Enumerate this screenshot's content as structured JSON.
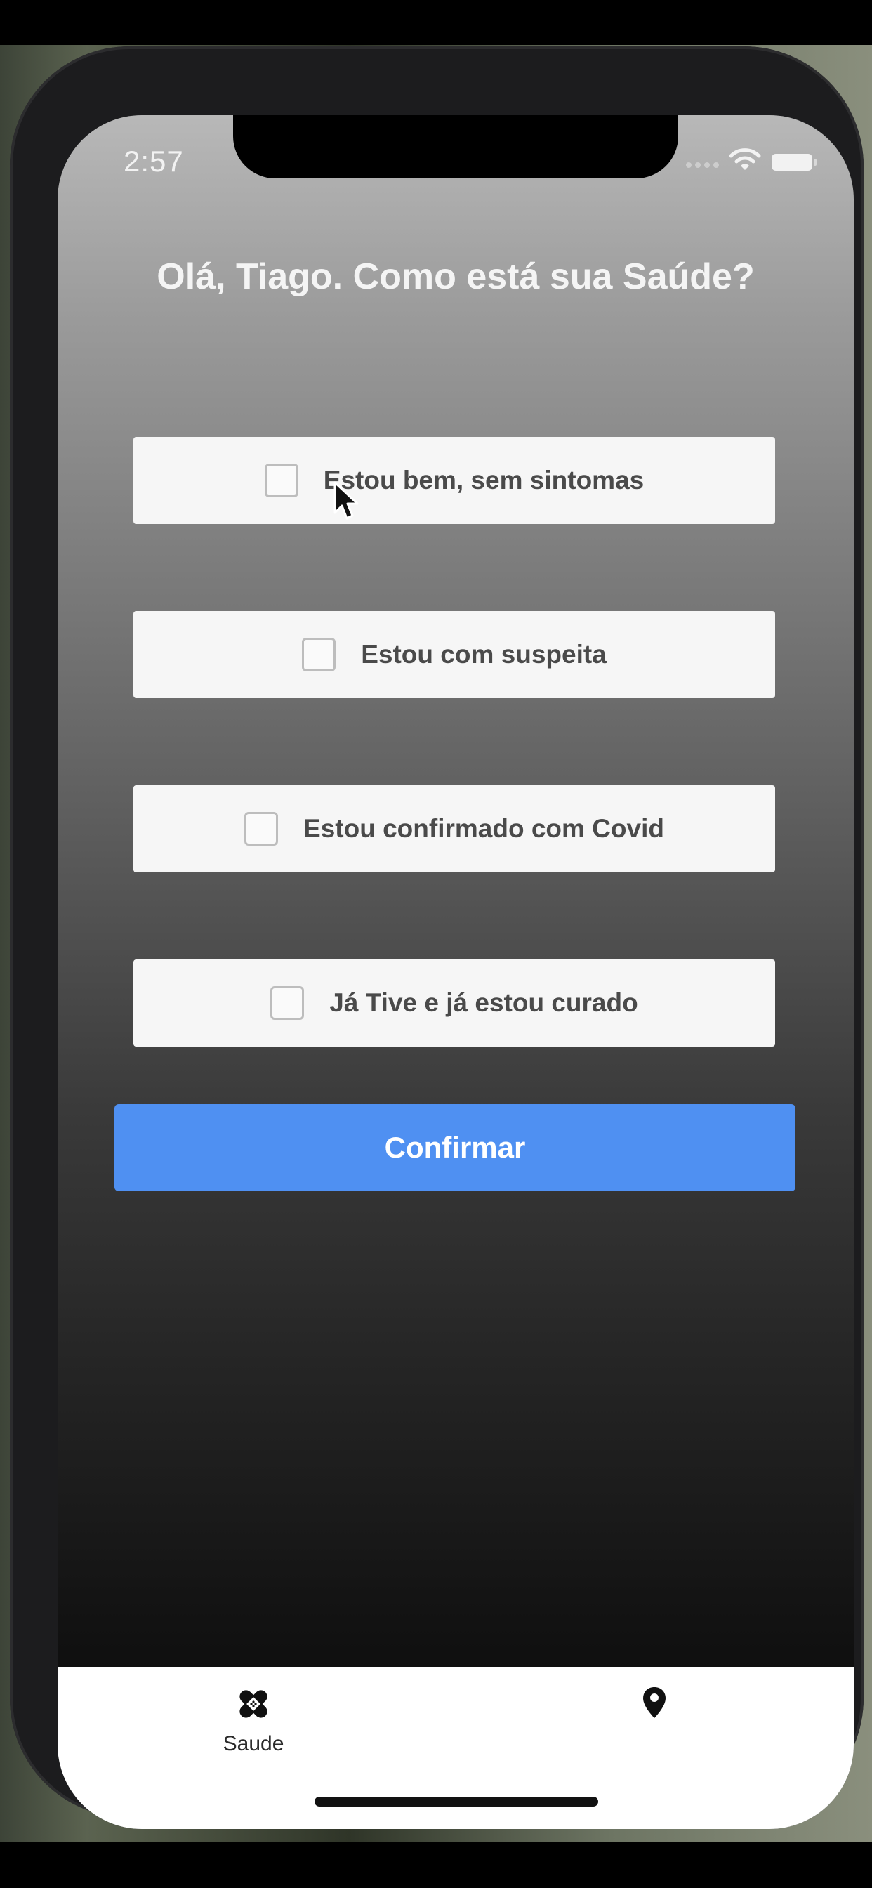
{
  "status_bar": {
    "time": "2:57"
  },
  "greeting": "Olá, Tiago. Como está sua Saúde?",
  "options": [
    {
      "label": "Estou bem, sem sintomas",
      "checked": false
    },
    {
      "label": "Estou com suspeita",
      "checked": false
    },
    {
      "label": "Estou confirmado com Covid",
      "checked": false
    },
    {
      "label": "Já Tive e já estou curado",
      "checked": false
    }
  ],
  "confirm_label": "Confirmar",
  "tab_bar": {
    "tabs": [
      {
        "label": "Saude",
        "icon": "bandage-icon"
      },
      {
        "label": "",
        "icon": "location-pin-icon"
      }
    ]
  },
  "colors": {
    "accent": "#4f90f2",
    "option_bg": "#f6f6f6",
    "option_text": "#4a4a4a"
  }
}
